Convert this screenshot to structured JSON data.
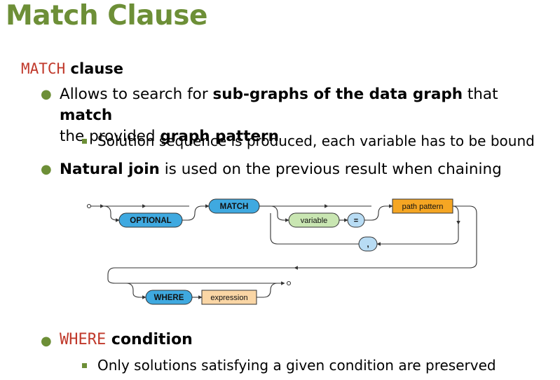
{
  "title": "Match Clause",
  "match_section": {
    "keyword": "MATCH",
    "heading": "clause",
    "bullet1": {
      "part1": "Allows to search for ",
      "bold1": "sub-graphs of the data graph",
      "part2": " that ",
      "bold2": "match",
      "part3": "the provided ",
      "bold3": "graph pattern"
    },
    "sub_bullet1": "Solution sequence is produced, each variable has to be bound",
    "bullet2": {
      "bold": "Natural join",
      "rest": " is used on the previous result when chaining"
    }
  },
  "diagram": {
    "optional": "OPTIONAL",
    "match": "MATCH",
    "variable": "variable",
    "equals": "=",
    "path_pattern": "path pattern",
    "comma": ",",
    "where": "WHERE",
    "expression": "expression",
    "colors": {
      "keyword_fill": "#3fa9e0",
      "variable_fill": "#c9e6b2",
      "equals_fill": "#b8dcf4",
      "path_fill": "#f5a623",
      "expression_fill": "#fad6a5"
    }
  },
  "where_section": {
    "keyword": "WHERE",
    "heading": "condition",
    "sub_bullet": "Only solutions satisfying a given condition are preserved"
  }
}
